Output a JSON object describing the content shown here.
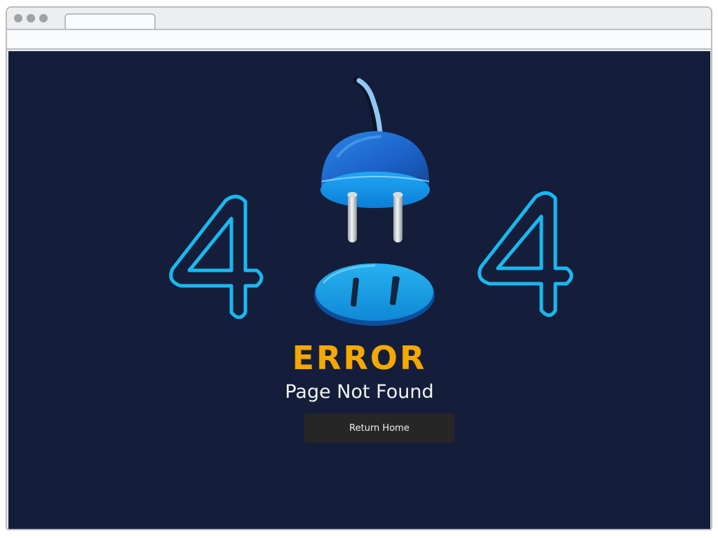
{
  "browser": {
    "window_controls": [
      "close-dot",
      "minimize-dot",
      "maximize-dot"
    ]
  },
  "page": {
    "left_digit": "4",
    "right_digit": "4",
    "error_title": "ERROR",
    "subtitle": "Page Not Found",
    "return_button_label": "Return Home"
  },
  "colors": {
    "background": "#141e3b",
    "digit_outline": "#1ab8f0",
    "error_title": "#f5a800",
    "subtitle": "#f2f2f2",
    "button_bg": "#262626",
    "plug_blue": "#1f6fd6",
    "socket_blue": "#1a9be0"
  },
  "icons": {
    "plug": "plug-icon",
    "socket": "socket-icon"
  }
}
